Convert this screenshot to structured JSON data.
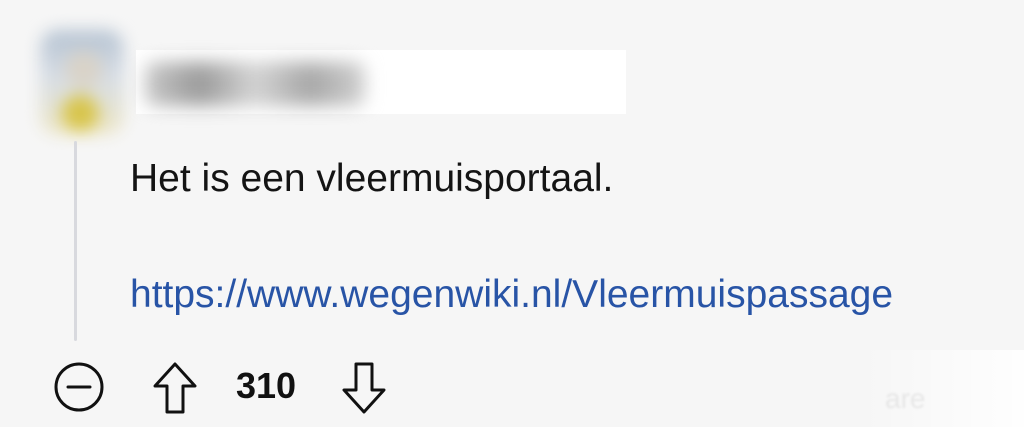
{
  "comment": {
    "text": "Het is een vleermuisportaal.",
    "link": "https://www.wegenwiki.nl/Vleermuispassage"
  },
  "actions": {
    "score": "310",
    "collapse_icon": "minus-circle-icon",
    "upvote_icon": "arrow-up-icon",
    "downvote_icon": "arrow-down-icon"
  },
  "colors": {
    "background": "#f6f6f6",
    "text": "#141414",
    "link": "#2854a6",
    "thread_line": "#d8d9de"
  }
}
